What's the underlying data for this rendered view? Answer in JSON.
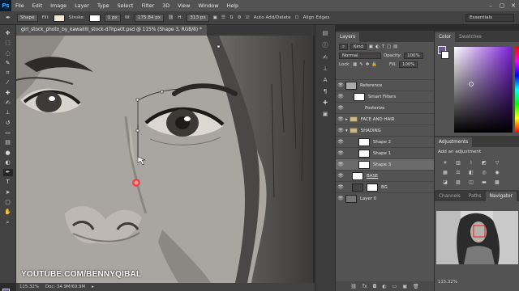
{
  "app": {
    "logo": "Ps",
    "menu": [
      "File",
      "Edit",
      "Image",
      "Layer",
      "Type",
      "Select",
      "Filter",
      "3D",
      "View",
      "Window",
      "Help"
    ]
  },
  "options": {
    "shape_mode": "Shape",
    "fill_label": "Fill:",
    "stroke_label": "Stroke:",
    "stroke_width": "1 px",
    "w_label": "W:",
    "w_value": "175.84 px",
    "h_label": "H:",
    "h_value": "313 px",
    "auto_add_delete": "Auto Add/Delete",
    "align_edges": "Align Edges",
    "workspace": "Essentials",
    "fill_color": "#f3ead5"
  },
  "document": {
    "tab_title": "girl_stock_photo_by_kawaiiIli_stock-d7hpa0t.psd @ 115% (Shape 3, RGB/8) *",
    "watermark": "YOUTUBE.COM/BENNYQIBAL"
  },
  "status": {
    "zoom": "115.32%",
    "doc": "Doc: 34.9M/69.9M"
  },
  "layers_panel": {
    "tabs": [
      "Layers"
    ],
    "kind_label": "Kind",
    "blend_mode": "Normal",
    "opacity_label": "Opacity:",
    "opacity_value": "100%",
    "lock_label": "Lock:",
    "fill_label": "Fill:",
    "fill_value": "100%",
    "layers": [
      {
        "name": "Reference",
        "type": "smart"
      },
      {
        "name": "Smart Filters",
        "type": "filter"
      },
      {
        "name": "Posterize",
        "type": "filter-item"
      },
      {
        "name": "FACE AND HAIR",
        "type": "group"
      },
      {
        "name": "SHADING",
        "type": "group"
      },
      {
        "name": "Shape 2",
        "type": "shape"
      },
      {
        "name": "Shape 1",
        "type": "shape"
      },
      {
        "name": "Shape 3",
        "type": "shape",
        "selected": true
      },
      {
        "name": "BASE",
        "type": "layer"
      },
      {
        "name": "BG",
        "type": "layer"
      },
      {
        "name": "Layer 0",
        "type": "layer"
      }
    ]
  },
  "color_panel": {
    "tabs": [
      "Color",
      "Swatches"
    ]
  },
  "adjustments_panel": {
    "title": "Adjustments",
    "subtitle": "Add an adjustment"
  },
  "navigator_panel": {
    "tabs": [
      "Channels",
      "Paths",
      "Navigator"
    ],
    "zoom": "115.32%"
  }
}
